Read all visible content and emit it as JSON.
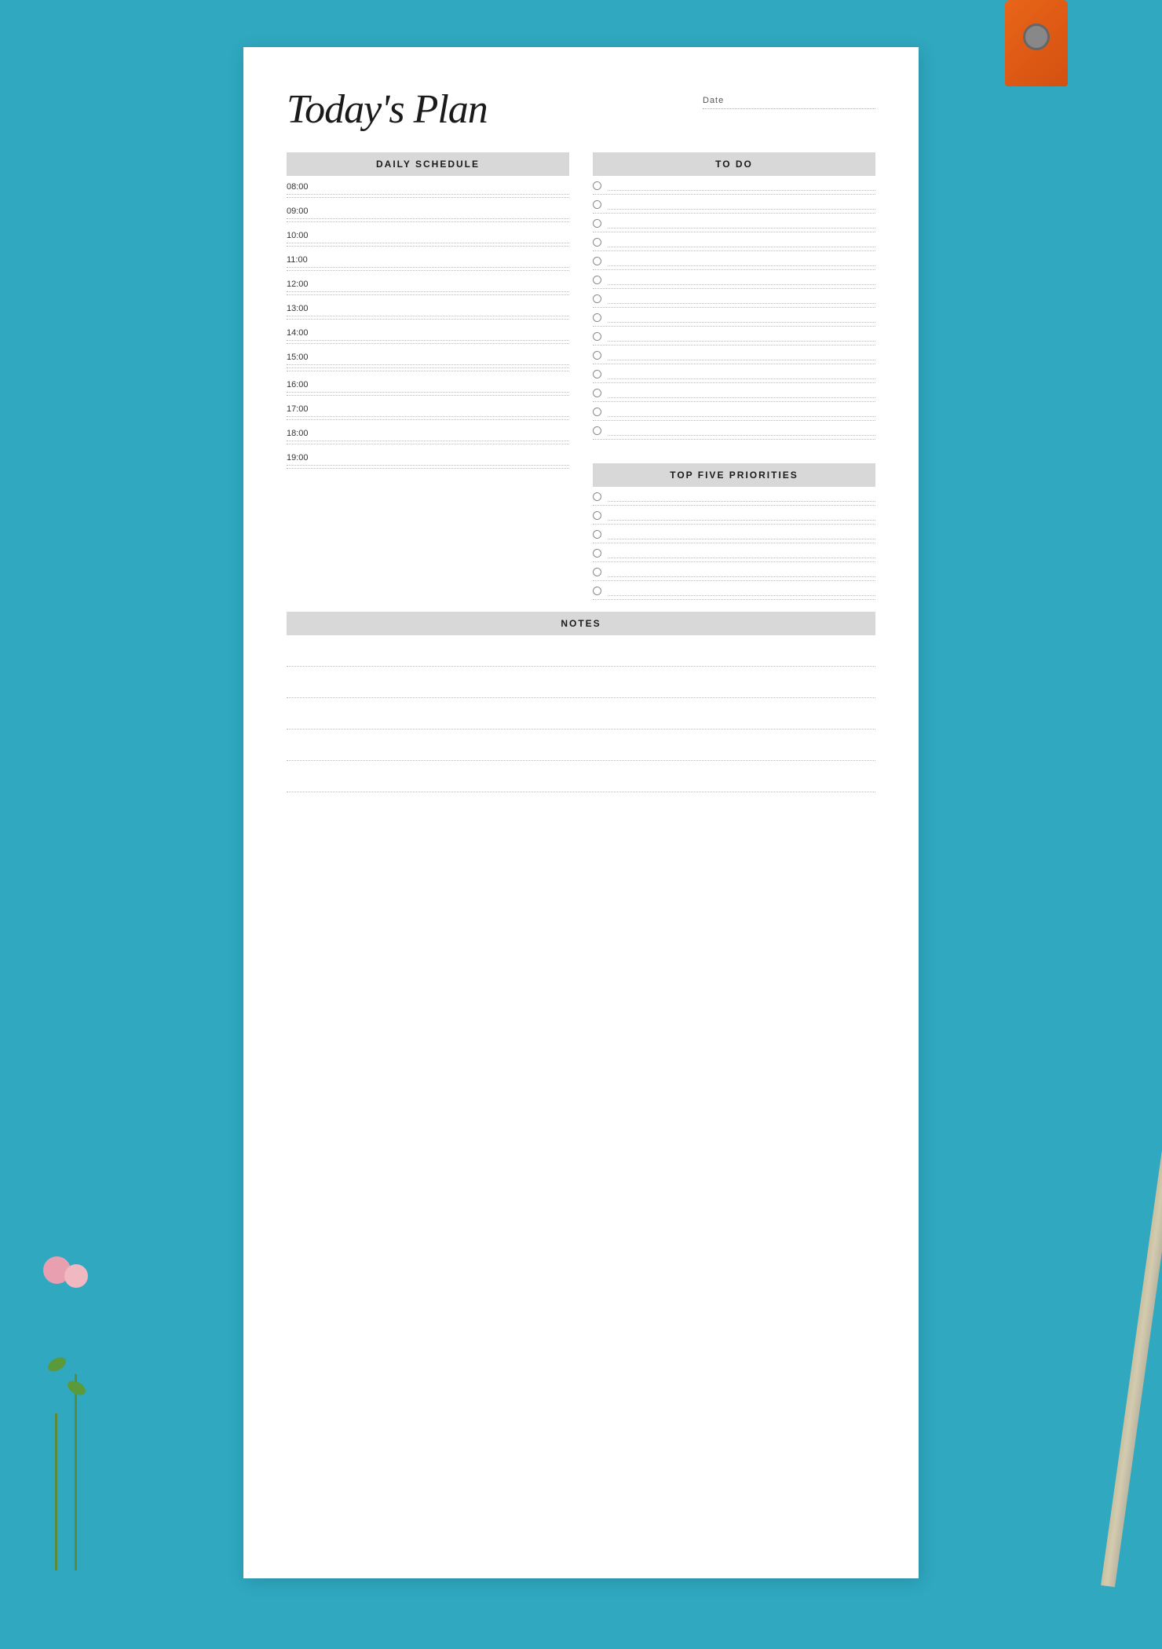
{
  "header": {
    "title": "Today's Plan",
    "date_label": "Date"
  },
  "schedule": {
    "section_label": "DAILY SCHEDULE",
    "time_slots": [
      "08:00",
      "09:00",
      "10:00",
      "11:00",
      "12:00",
      "13:00",
      "14:00",
      "15:00",
      "16:00",
      "17:00",
      "18:00",
      "19:00"
    ]
  },
  "todo": {
    "section_label": "TO DO",
    "items_count": 14
  },
  "priorities": {
    "section_label": "TOP FIVE PRIORITIES",
    "items_count": 6
  },
  "notes": {
    "section_label": "NOTES",
    "lines_count": 5
  }
}
